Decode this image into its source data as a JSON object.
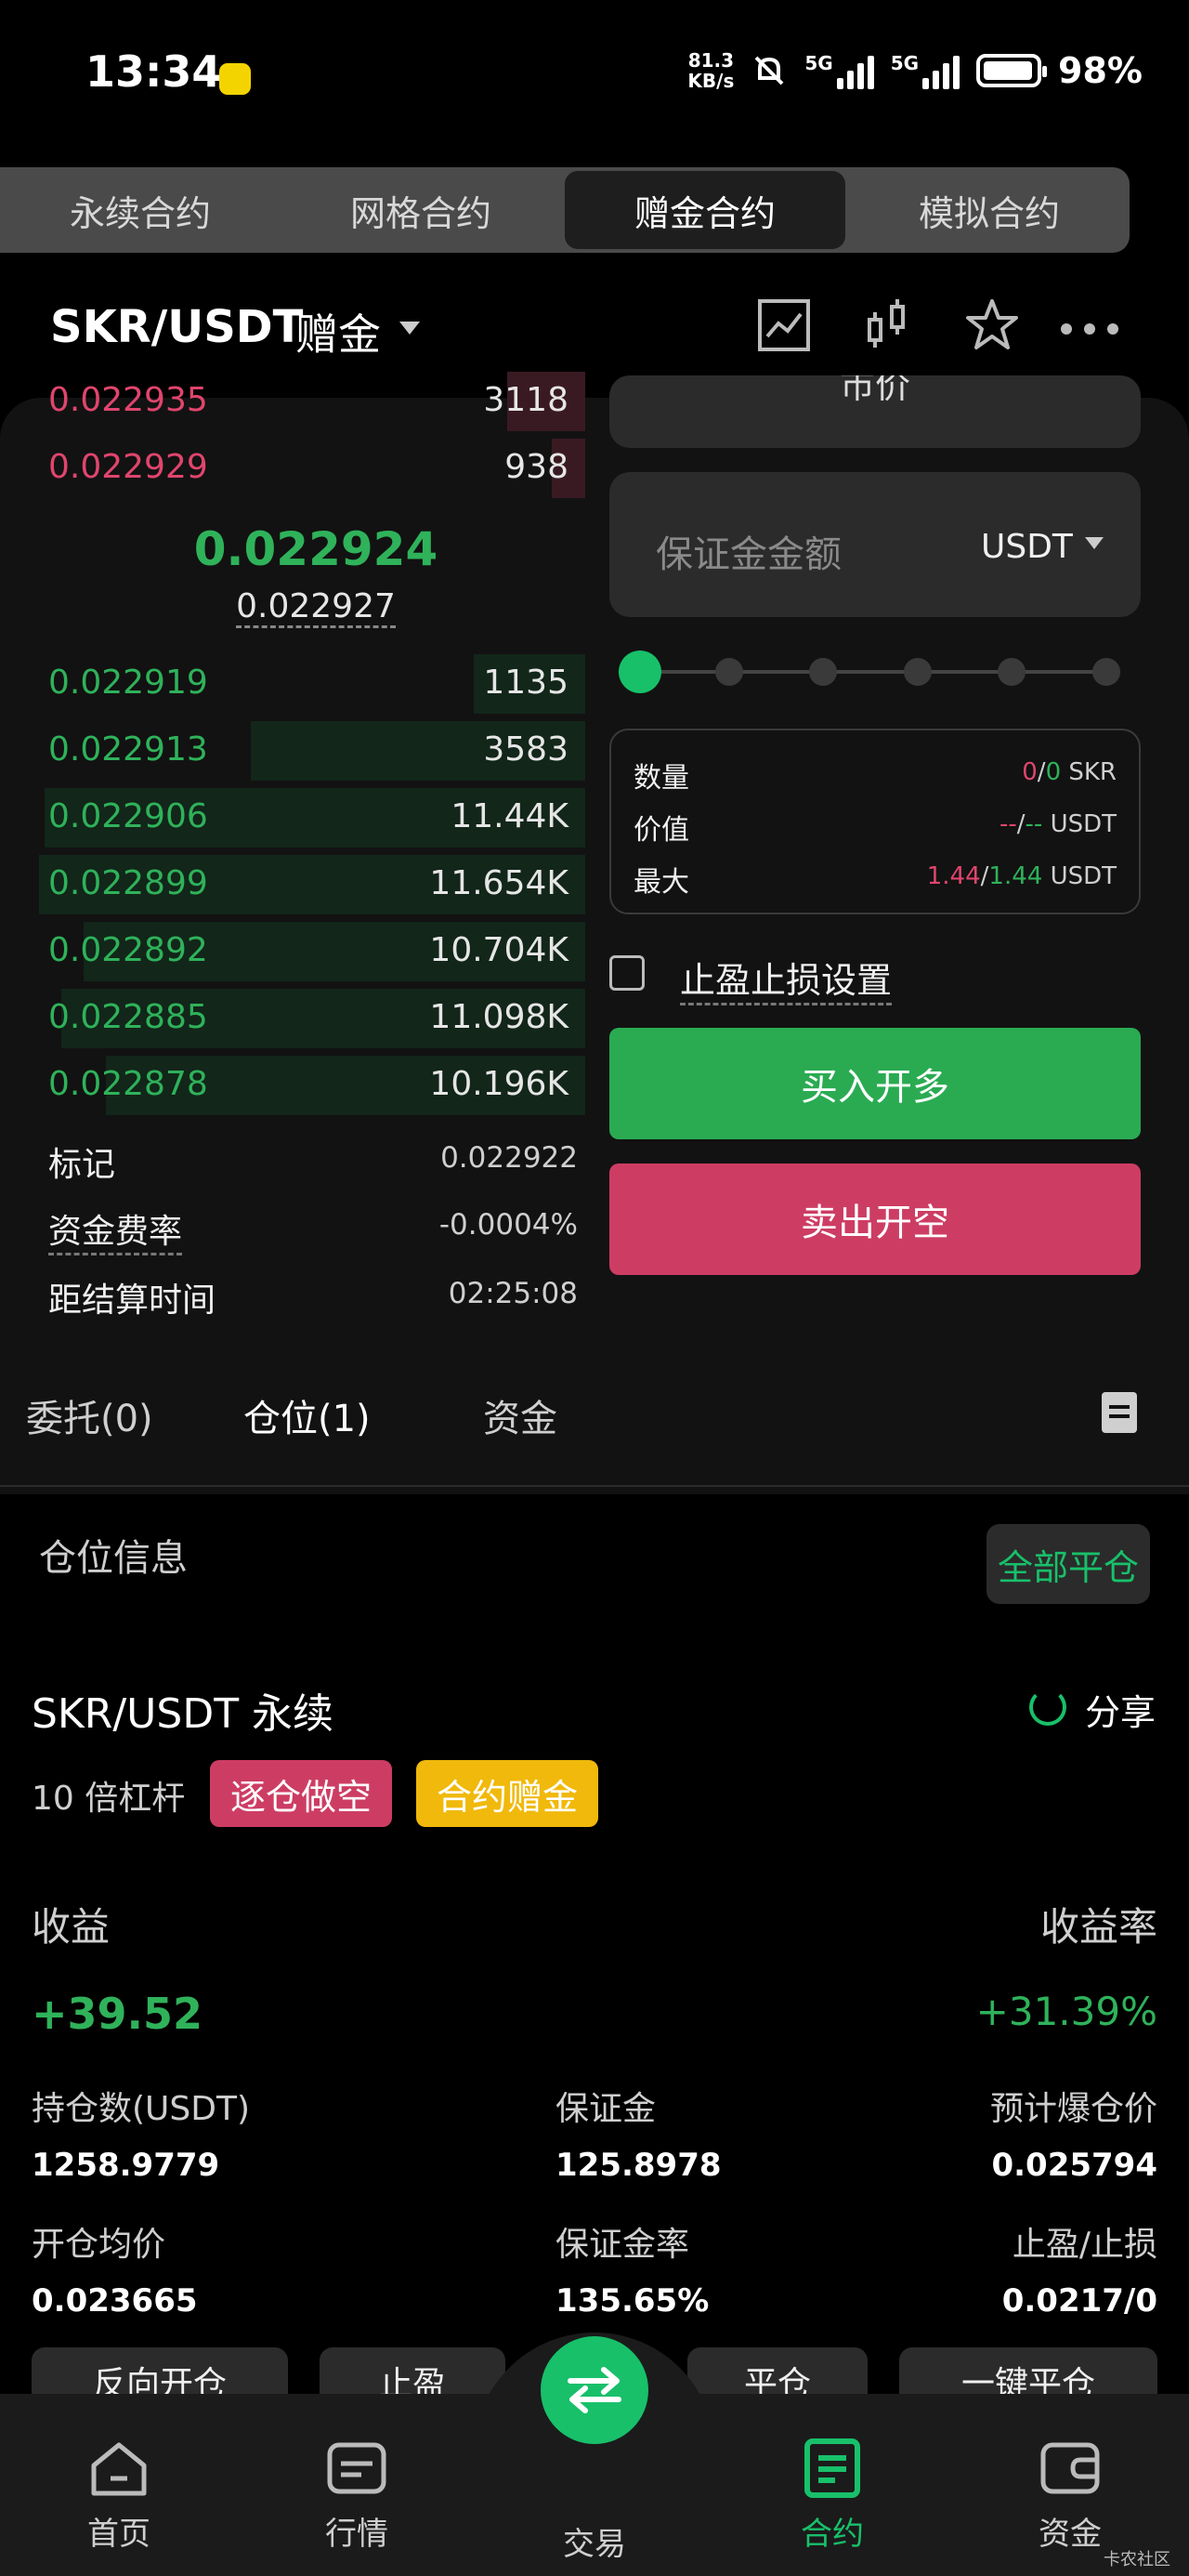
{
  "status_bar": {
    "time": "13:34",
    "net_speed_value": "81.3",
    "net_speed_unit": "KB/s",
    "sim1": "5G",
    "sim2": "5G",
    "battery": "98%"
  },
  "top_tabs": [
    {
      "label": "永续合约",
      "active": false
    },
    {
      "label": "网格合约",
      "active": false
    },
    {
      "label": "赠金合约",
      "active": true
    },
    {
      "label": "模拟合约",
      "active": false
    }
  ],
  "header": {
    "pair": "SKR/USDT",
    "mode": "赠金",
    "icons": [
      "chart-icon",
      "candlestick-icon",
      "star-icon",
      "more-icon"
    ]
  },
  "order_book": {
    "asks": [
      {
        "price": "0.022935",
        "qty": "3118",
        "depth": 0.14
      },
      {
        "price": "0.022929",
        "qty": "938",
        "depth": 0.06
      }
    ],
    "last_price": "0.022924",
    "mark_price_under": "0.022927",
    "bids": [
      {
        "price": "0.022919",
        "qty": "1135",
        "depth": 0.2
      },
      {
        "price": "0.022913",
        "qty": "3583",
        "depth": 0.6
      },
      {
        "price": "0.022906",
        "qty": "11.44K",
        "depth": 0.97
      },
      {
        "price": "0.022899",
        "qty": "11.654K",
        "depth": 0.98
      },
      {
        "price": "0.022892",
        "qty": "10.704K",
        "depth": 0.9
      },
      {
        "price": "0.022885",
        "qty": "11.098K",
        "depth": 0.94
      },
      {
        "price": "0.022878",
        "qty": "10.196K",
        "depth": 0.86
      }
    ]
  },
  "market_info": {
    "mark_label": "标记",
    "mark_value": "0.022922",
    "funding_label": "资金费率",
    "funding_value": "-0.0004%",
    "settle_label": "距结算时间",
    "settle_value": "02:25:08"
  },
  "order_form": {
    "order_type_partial": "市价",
    "margin_placeholder": "保证金金额",
    "margin_unit": "USDT",
    "slider_steps": 6,
    "slider_value": 0,
    "qty_label": "数量",
    "qty_value_a": "0",
    "qty_sep": "/",
    "qty_value_b": "0",
    "qty_unit": "SKR",
    "value_label": "价值",
    "value_a": "--",
    "value_b": "--",
    "value_unit": "USDT",
    "max_label": "最大",
    "max_a": "1.44",
    "max_b": "1.44",
    "max_unit": "USDT",
    "tpsl_label": "止盈止损设置",
    "buy_label": "买入开多",
    "sell_label": "卖出开空"
  },
  "sub_tabs": [
    {
      "label": "委托(0)",
      "active": false
    },
    {
      "label": "仓位(1)",
      "active": true
    },
    {
      "label": "资金",
      "active": false
    }
  ],
  "positions": {
    "section_title": "仓位信息",
    "close_all": "全部平仓",
    "pair": "SKR/USDT 永续",
    "share": "分享",
    "leverage": "10 倍杠杆",
    "tag_side": "逐仓做空",
    "tag_bonus": "合约赠金",
    "pnl_label": "收益",
    "pnl_rate_label": "收益率",
    "pnl_value": "+39.52",
    "pnl_rate": "+31.39%",
    "size_label": "持仓数(USDT)",
    "size_value": "1258.9779",
    "margin_label": "保证金",
    "margin_value": "125.8978",
    "liq_label": "预计爆仓价",
    "liq_value": "0.025794",
    "entry_label": "开仓均价",
    "entry_value": "0.023665",
    "margin_rate_label": "保证金率",
    "margin_rate_value": "135.65%",
    "tpsl_label": "止盈/止损",
    "tpsl_value": "0.0217/0",
    "actions": [
      "反向开仓",
      "止盈",
      "平仓",
      "一键平仓"
    ]
  },
  "bottom_nav": [
    {
      "label": "首页",
      "icon": "home-icon",
      "active": false
    },
    {
      "label": "行情",
      "icon": "market-icon",
      "active": false
    },
    {
      "label": "交易",
      "icon": "swap-icon",
      "active": false
    },
    {
      "label": "合约",
      "icon": "contract-icon",
      "active": true
    },
    {
      "label": "资金",
      "icon": "wallet-icon",
      "active": false
    }
  ],
  "watermark": "卡农社区",
  "colors": {
    "green": "#2fb25a",
    "accent": "#18c06a",
    "red": "#e0456e",
    "sell": "#cd3d63",
    "bonus": "#f0b90b"
  }
}
